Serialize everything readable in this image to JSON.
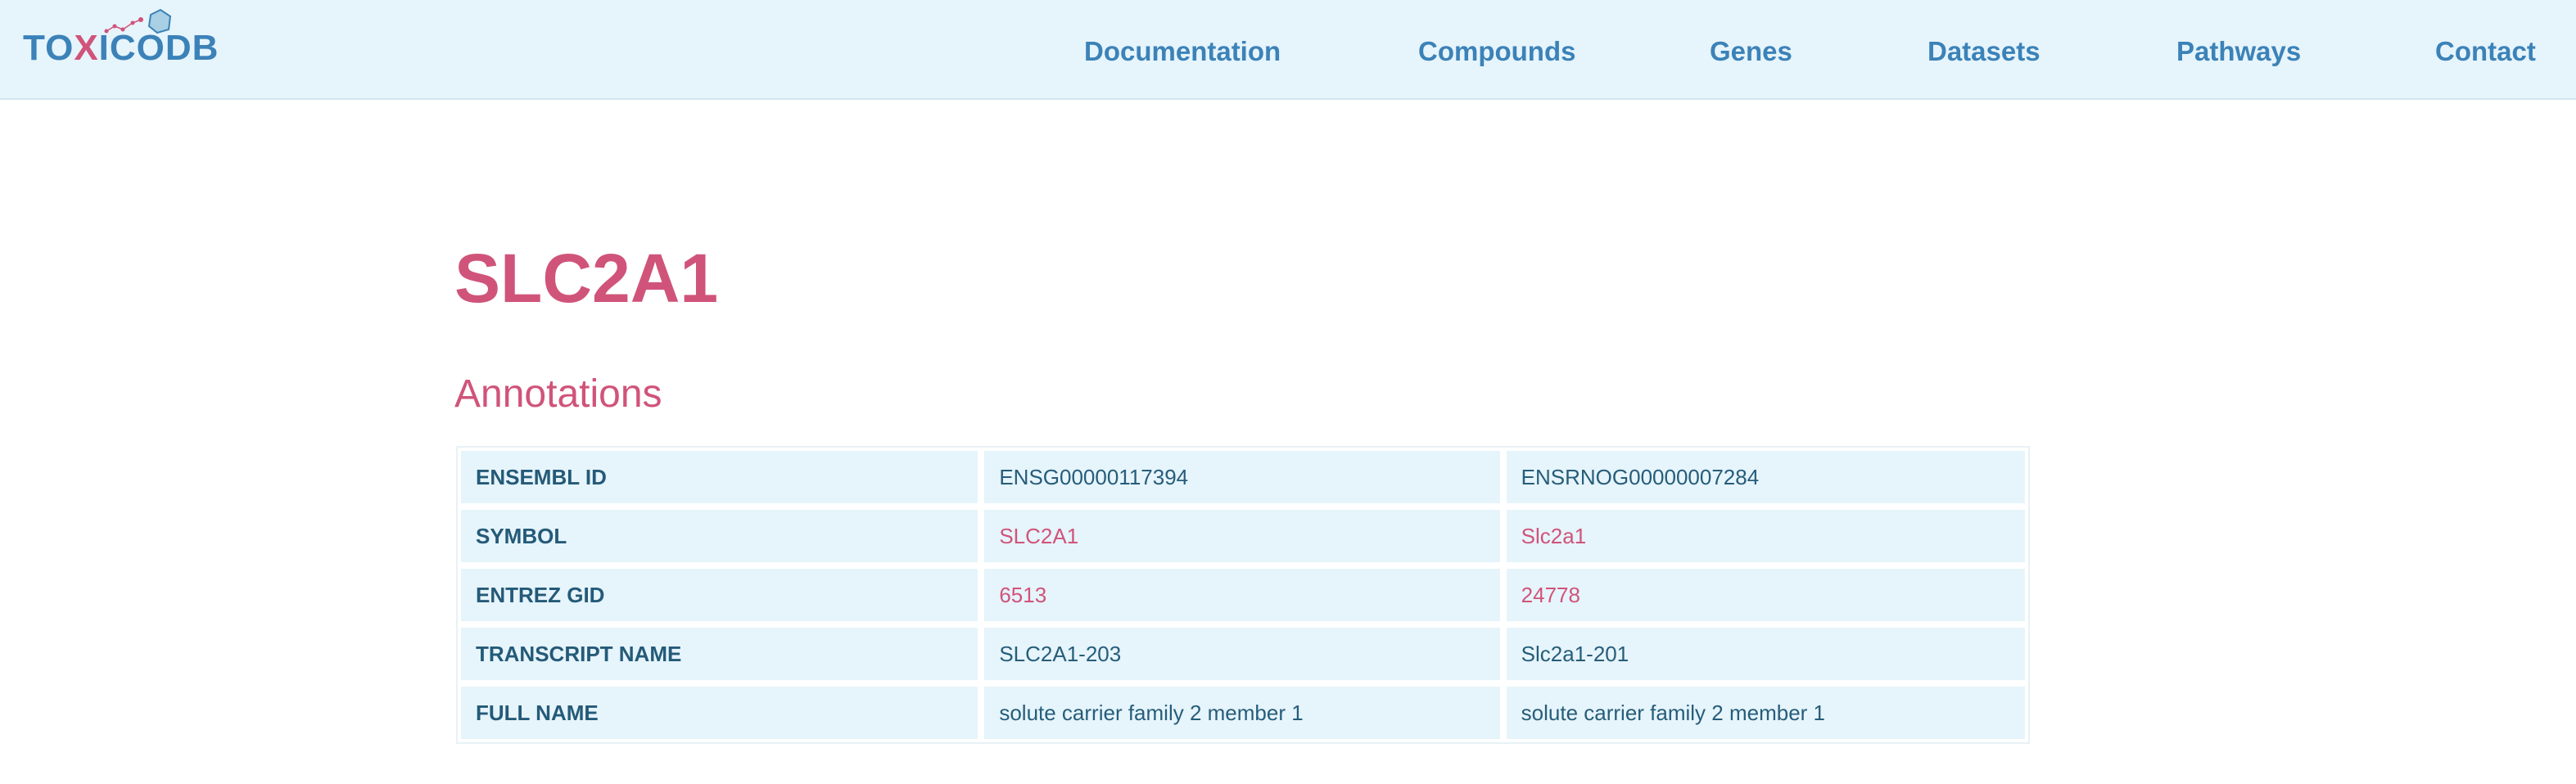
{
  "navbar": {
    "logo_text_pre": "TO",
    "logo_text_x": "X",
    "logo_text_post": "ICODB",
    "links": [
      {
        "label": "Documentation"
      },
      {
        "label": "Compounds"
      },
      {
        "label": "Genes"
      },
      {
        "label": "Datasets"
      },
      {
        "label": "Pathways"
      },
      {
        "label": "Contact"
      }
    ]
  },
  "page": {
    "title": "SLC2A1",
    "section_title": "Annotations"
  },
  "annotations": {
    "rows": [
      {
        "label": "ENSEMBL ID",
        "human": "ENSG00000117394",
        "rat": "ENSRNOG00000007284",
        "link": false
      },
      {
        "label": "SYMBOL",
        "human": "SLC2A1",
        "rat": "Slc2a1",
        "link": true
      },
      {
        "label": "ENTREZ GID",
        "human": "6513",
        "rat": "24778",
        "link": true
      },
      {
        "label": "TRANSCRIPT NAME",
        "human": "SLC2A1-203",
        "rat": "Slc2a1-201",
        "link": false
      },
      {
        "label": "FULL NAME",
        "human": "solute carrier family 2 member 1",
        "rat": "solute carrier family 2 member 1",
        "link": false
      }
    ]
  },
  "colors": {
    "accent_pink": "#d0547a",
    "nav_blue": "#3b82b8",
    "cell_bg": "#e6f4fb"
  }
}
